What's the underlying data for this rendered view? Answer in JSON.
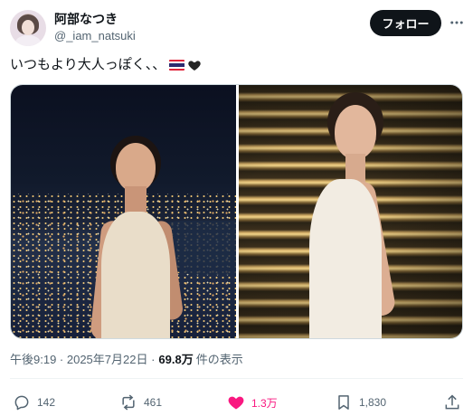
{
  "user": {
    "display_name": "阿部なつき",
    "handle": "@_iam_natsuki",
    "avatar_icon": "profile-avatar"
  },
  "header": {
    "follow_label": "フォロー",
    "more_icon": "more-dots-icon"
  },
  "tweet": {
    "text": "いつもより大人っぽく、、",
    "emojis": [
      "thailand-flag",
      "black-heart"
    ]
  },
  "media": {
    "count": 2,
    "photos": [
      "night-city-portrait",
      "stairs-lights-portrait"
    ]
  },
  "meta": {
    "timestamp": "午後9:19 · 2025年7月22日 · ",
    "views": "69.8万",
    "views_label": "件の表示"
  },
  "actions": {
    "replies": "142",
    "reposts": "461",
    "likes": "1.3万",
    "bookmarks": "1,830",
    "like_color": "#f91880",
    "icons": [
      "reply-icon",
      "repost-icon",
      "like-icon",
      "bookmark-icon",
      "share-icon"
    ]
  }
}
